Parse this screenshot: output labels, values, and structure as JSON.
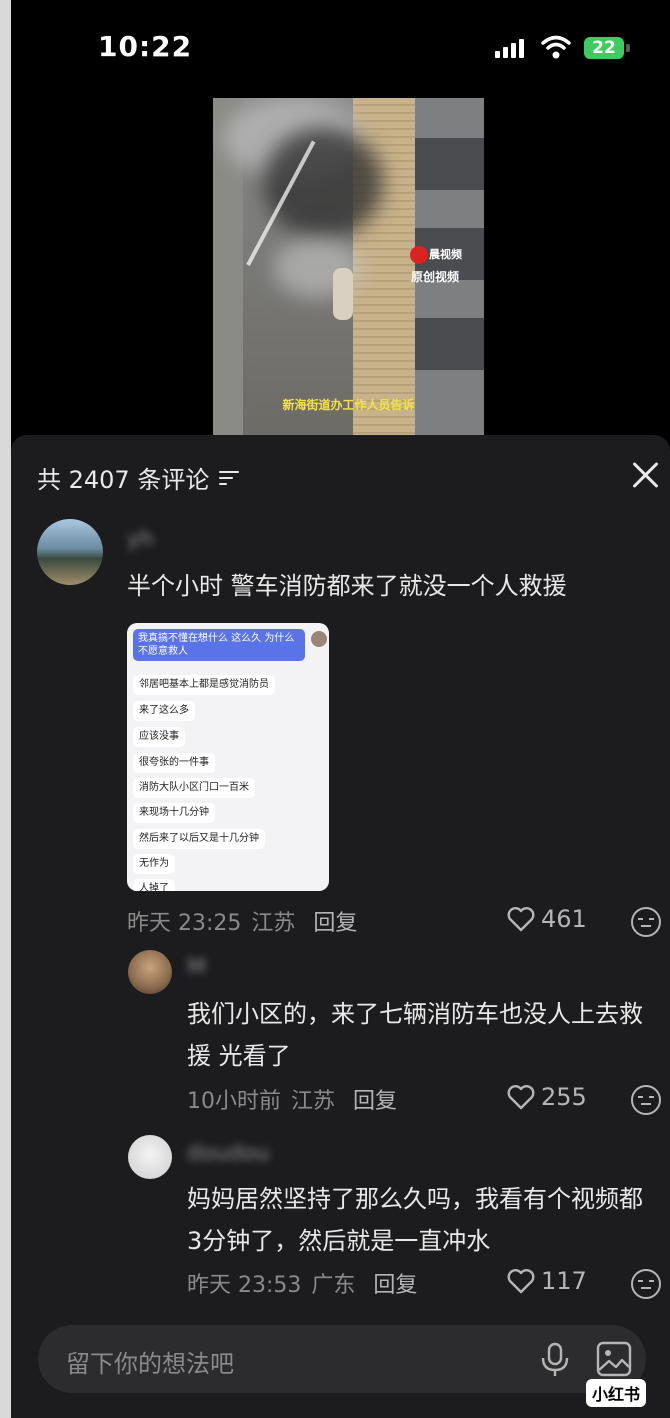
{
  "status_bar": {
    "time": "10:22",
    "battery": "22"
  },
  "video": {
    "watermark_line1": "晨视频",
    "watermark_line2": "原创视频",
    "caption": "新海街道办工作人员告诉"
  },
  "comments_panel": {
    "count_label": "共 2407 条评论",
    "comments": [
      {
        "username": "yh",
        "text": "半个小时 警车消防都来了就没一个人救援",
        "time": "昨天 23:25",
        "location": "江苏",
        "reply_label": "回复",
        "likes": "461",
        "image": {
          "blue_message": "我真搞不懂在想什么 这么久 为什么不愿意救人",
          "messages": [
            "邻居吧基本上都是感觉消防员",
            "来了这么多",
            "应该没事",
            "很夸张的一件事",
            "消防大队小区门口一百米",
            "来现场十几分钟",
            "然后来了以后又是十几分钟",
            "无作为",
            "人掉了"
          ]
        }
      },
      {
        "username": "M",
        "text": "我们小区的，来了七辆消防车也没人上去救援 光看了",
        "time": "10小时前",
        "location": "江苏",
        "reply_label": "回复",
        "likes": "255"
      },
      {
        "username": "doudou",
        "text": "妈妈居然坚持了那么久吗，我看有个视频都3分钟了，然后就是一直冲水",
        "time": "昨天 23:53",
        "location": "广东",
        "reply_label": "回复",
        "likes": "117"
      }
    ]
  },
  "input": {
    "placeholder": "留下你的想法吧"
  },
  "brand_watermark": "小红书"
}
